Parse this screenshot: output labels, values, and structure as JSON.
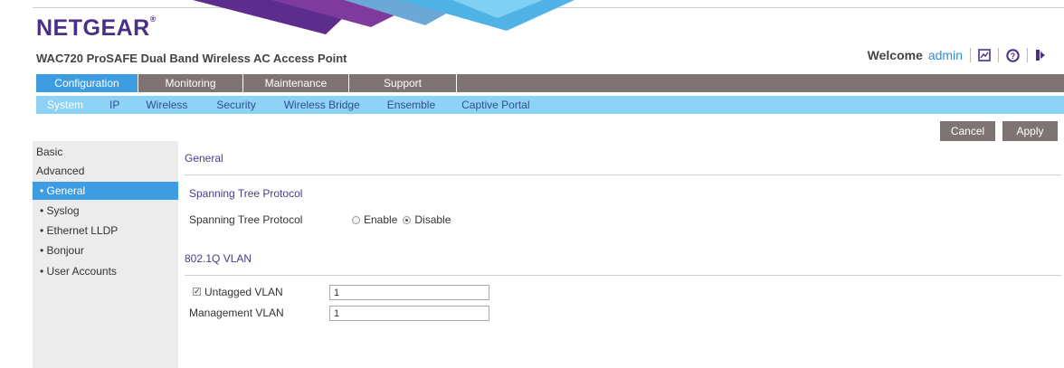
{
  "brand": {
    "logo": "NETGEAR",
    "trademark": "®",
    "product_title": "WAC720 ProSAFE Dual Band Wireless AC Access Point"
  },
  "header": {
    "welcome_label": "Welcome",
    "username": "admin"
  },
  "icons": {
    "status": "status-chart-icon",
    "help": "help-icon",
    "logout": "logout-icon"
  },
  "main_nav": [
    {
      "label": "Configuration",
      "active": true
    },
    {
      "label": "Monitoring",
      "active": false
    },
    {
      "label": "Maintenance",
      "active": false
    },
    {
      "label": "Support",
      "active": false
    }
  ],
  "sub_nav": [
    {
      "label": "System",
      "active": true
    },
    {
      "label": "IP",
      "active": false
    },
    {
      "label": "Wireless",
      "active": false
    },
    {
      "label": "Security",
      "active": false
    },
    {
      "label": "Wireless Bridge",
      "active": false
    },
    {
      "label": "Ensemble",
      "active": false
    },
    {
      "label": "Captive Portal",
      "active": false
    }
  ],
  "actions": {
    "cancel": "Cancel",
    "apply": "Apply"
  },
  "sidebar": {
    "basic": "Basic",
    "advanced": "Advanced",
    "items": [
      {
        "label": "• General",
        "active": true
      },
      {
        "label": "• Syslog",
        "active": false
      },
      {
        "label": "• Ethernet LLDP",
        "active": false
      },
      {
        "label": "• Bonjour",
        "active": false
      },
      {
        "label": "• User Accounts",
        "active": false
      }
    ]
  },
  "content": {
    "section_title": "General",
    "stp_heading": "Spanning Tree Protocol",
    "stp_label": "Spanning Tree Protocol",
    "stp_options": {
      "enable": "Enable",
      "disable": "Disable",
      "selected": "disable"
    },
    "vlan_heading": "802.1Q VLAN",
    "untagged_label": "Untagged VLAN",
    "untagged_checked": true,
    "untagged_value": "1",
    "mgmt_label": "Management VLAN",
    "mgmt_value": "1"
  },
  "colors": {
    "brand_purple": "#4a2f87",
    "nav_gray": "#7d7473",
    "nav_active_blue": "#3d9de0",
    "subnav_blue": "#8ed2f5"
  }
}
